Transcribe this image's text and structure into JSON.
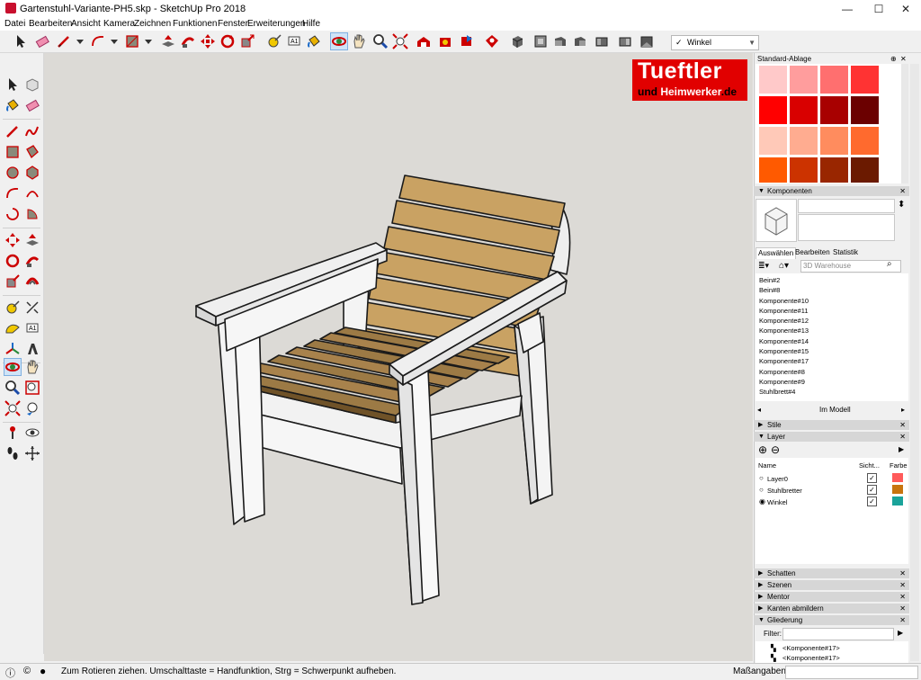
{
  "window": {
    "title": "Gartenstuhl-Variante-PH5.skp - SketchUp Pro 2018",
    "minimize": "—",
    "maximize": "☐",
    "close": "✕"
  },
  "menu": [
    "Datei",
    "Bearbeiten",
    "Ansicht",
    "Kamera",
    "Zeichnen",
    "Funktionen",
    "Fenster",
    "Erweiterungen",
    "Hilfe"
  ],
  "toolbar": {
    "style_selected": "Winkel",
    "style_check": "✓"
  },
  "logo": {
    "line1": "Tueftler",
    "line2a": "und ",
    "line2b": "Heimwerker",
    "line2c": ".de"
  },
  "tray": {
    "material_panel": "Standard-Ablage",
    "material_colors": [
      "#ffc9c9",
      "#ff9d9d",
      "#ff6f6f",
      "#ff3333",
      "#ff0000",
      "#d90000",
      "#a80000",
      "#6b0000",
      "#ffc9b8",
      "#ffac90",
      "#ff8c5e",
      "#ff6a2e",
      "#ff5a00",
      "#cc3300",
      "#992600",
      "#6b1a00"
    ],
    "components": {
      "header": "Komponenten",
      "tabs": [
        "Auswählen",
        "Bearbeiten",
        "Statistik"
      ],
      "search_placeholder": "3D Warehouse",
      "items": [
        "Bein#2",
        "Bein#8",
        "Komponente#10",
        "Komponente#11",
        "Komponente#12",
        "Komponente#13",
        "Komponente#14",
        "Komponente#15",
        "Komponente#17",
        "Komponente#8",
        "Komponente#9",
        "Stuhlbrett#4"
      ],
      "footer": "Im Modell"
    },
    "styles_header": "Stile",
    "layers": {
      "header": "Layer",
      "col_name": "Name",
      "col_visible": "Sicht...",
      "col_color": "Farbe",
      "rows": [
        {
          "name": "Layer0",
          "color": "#ff5a5a",
          "active": false
        },
        {
          "name": "Stuhlbretter",
          "color": "#c8740e",
          "active": false
        },
        {
          "name": "Winkel",
          "color": "#1aa39a",
          "active": true
        }
      ]
    },
    "collapsed": [
      "Schatten",
      "Szenen",
      "Mentor",
      "Kanten abmildern"
    ],
    "outliner": {
      "header": "Gliederung",
      "filter_label": "Filter:",
      "items": [
        "<Komponente#17>",
        "<Komponente#17>"
      ]
    }
  },
  "status": {
    "message": "Zum Rotieren ziehen. Umschalttaste = Handfunktion, Strg = Schwerpunkt aufheben.",
    "measurements_label": "Maßangaben"
  }
}
